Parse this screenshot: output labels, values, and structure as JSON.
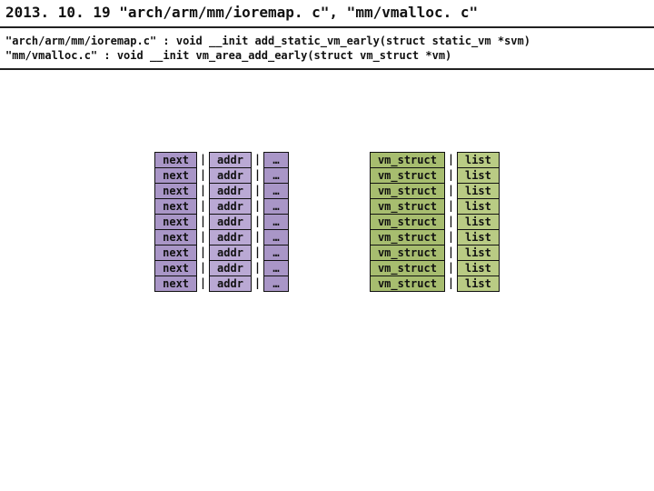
{
  "title": "2013. 10. 19  \"arch/arm/mm/ioremap. c\",  \"mm/vmalloc. c\"",
  "sub1": "\"arch/arm/mm/ioremap.c\" : void __init add_static_vm_early(struct static_vm *svm)",
  "sub2": "\"mm/vmalloc.c\" : void __init vm_area_add_early(struct vm_struct *vm)",
  "left_cols": [
    "next",
    "addr",
    "…"
  ],
  "right_cols": [
    "vm_struct",
    "list"
  ],
  "row_count": 9
}
